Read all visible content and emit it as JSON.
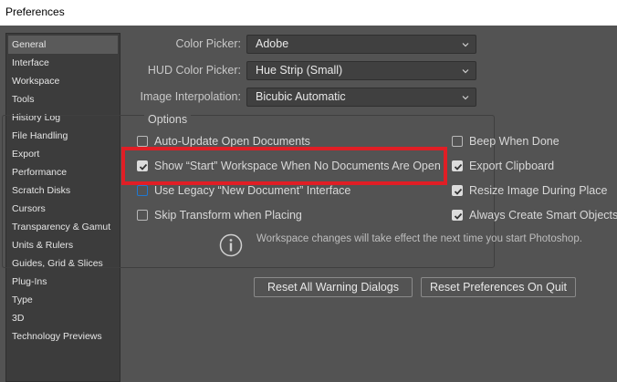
{
  "window": {
    "title": "Preferences"
  },
  "sidebar": {
    "items": [
      {
        "label": "General",
        "selected": true
      },
      {
        "label": "Interface"
      },
      {
        "label": "Workspace"
      },
      {
        "label": "Tools"
      },
      {
        "label": "History Log"
      },
      {
        "label": "File Handling"
      },
      {
        "label": "Export"
      },
      {
        "label": "Performance"
      },
      {
        "label": "Scratch Disks"
      },
      {
        "label": "Cursors"
      },
      {
        "label": "Transparency & Gamut"
      },
      {
        "label": "Units & Rulers"
      },
      {
        "label": "Guides, Grid & Slices"
      },
      {
        "label": "Plug-Ins"
      },
      {
        "label": "Type"
      },
      {
        "label": "3D"
      },
      {
        "label": "Technology Previews"
      }
    ]
  },
  "general": {
    "color_picker": {
      "label": "Color Picker:",
      "value": "Adobe"
    },
    "hud_color_picker": {
      "label": "HUD Color Picker:",
      "value": "Hue Strip (Small)"
    },
    "image_interpolation": {
      "label": "Image Interpolation:",
      "value": "Bicubic Automatic"
    }
  },
  "options": {
    "title": "Options",
    "left": [
      {
        "label": "Auto-Update Open Documents",
        "checked": false
      },
      {
        "label": "Show “Start” Workspace When No Documents Are Open",
        "checked": true
      },
      {
        "label": "Use Legacy “New Document” Interface",
        "checked": false
      },
      {
        "label": "Skip Transform when Placing",
        "checked": false
      }
    ],
    "right": [
      {
        "label": "Beep When Done",
        "checked": false
      },
      {
        "label": "Export Clipboard",
        "checked": true
      },
      {
        "label": "Resize Image During Place",
        "checked": true
      },
      {
        "label": "Always Create Smart Objects",
        "checked": true
      }
    ],
    "info": "Workspace changes will take effect the next time you start Photoshop."
  },
  "buttons": {
    "reset_warnings": "Reset All Warning Dialogs",
    "reset_prefs": "Reset Preferences On Quit"
  },
  "colors": {
    "highlight": "#e01e25",
    "dialog_bg": "#535353",
    "sidebar_bg": "#3c3c3c",
    "focus": "#1f78d1"
  }
}
